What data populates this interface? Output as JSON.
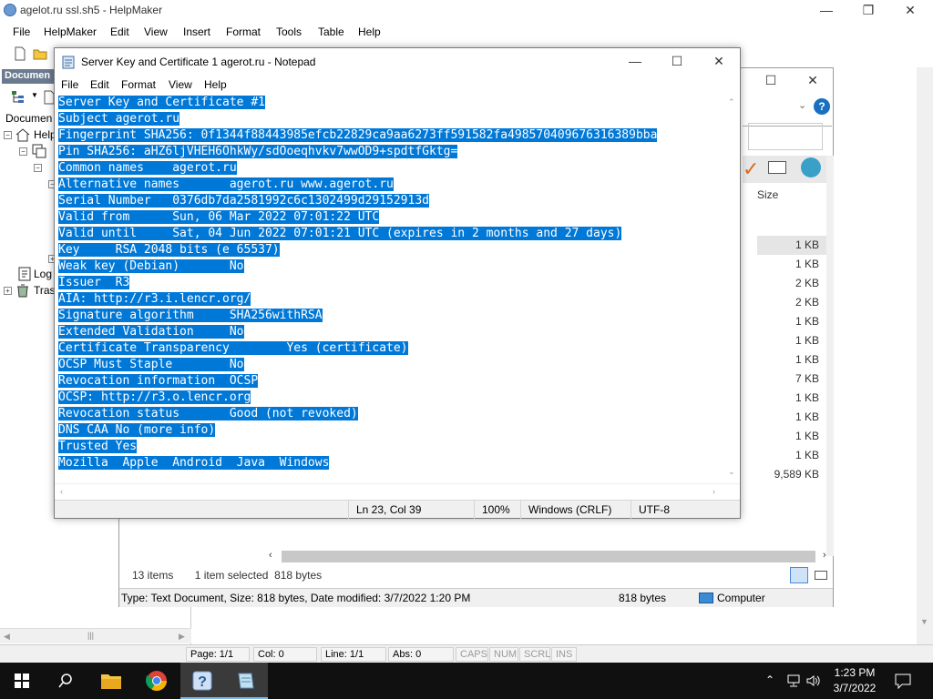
{
  "helpmaker": {
    "title": "agelot.ru ssl.sh5 - HelpMaker",
    "menu": [
      "File",
      "HelpMaker",
      "Edit",
      "View",
      "Insert",
      "Format",
      "Tools",
      "Table",
      "Help"
    ],
    "panel_header": "Documen",
    "panel_label": "Documen",
    "tree": [
      "Help",
      "Log",
      "Tras"
    ],
    "status": {
      "page": "Page: 1/1",
      "col": "Col: 0",
      "line": "Line: 1/1",
      "abs": "Abs: 0",
      "caps": "CAPS",
      "num": "NUM",
      "scrl": "SCRL",
      "ins": "INS"
    }
  },
  "explorer": {
    "column_size": "Size",
    "sizes": [
      "1 KB",
      "1 KB",
      "2 KB",
      "2 KB",
      "1 KB",
      "1 KB",
      "1 KB",
      "7 KB",
      "1 KB",
      "1 KB",
      "1 KB",
      "1 KB",
      "9,589 KB"
    ],
    "selected_index": 0,
    "items_count": "13 items",
    "selection": "1 item selected  818 bytes",
    "status_text": "Type: Text Document, Size: 818 bytes, Date modified: 3/7/2022 1:20 PM",
    "status_size": "818 bytes",
    "status_location": "Computer"
  },
  "notepad": {
    "title": "Server Key and Certificate 1 agerot.ru - Notepad",
    "menu": [
      "File",
      "Edit",
      "Format",
      "View",
      "Help"
    ],
    "lines": [
      "Server Key and Certificate #1",
      "Subject agerot.ru",
      "Fingerprint SHA256: 0f1344f88443985efcb22829ca9aa6273ff591582fa498570409676316389bba",
      "Pin SHA256: aHZ6ljVHEH6OhkWy/sdOoeqhvkv7wwOD9+spdtfGktg=",
      "Common names    agerot.ru",
      "Alternative names       agerot.ru www.agerot.ru",
      "Serial Number   0376db7da2581992c6c1302499d29152913d",
      "Valid from      Sun, 06 Mar 2022 07:01:22 UTC",
      "Valid until     Sat, 04 Jun 2022 07:01:21 UTC (expires in 2 months and 27 days)",
      "Key     RSA 2048 bits (e 65537)",
      "Weak key (Debian)       No",
      "Issuer  R3",
      "AIA: http://r3.i.lencr.org/",
      "Signature algorithm     SHA256withRSA",
      "Extended Validation     No",
      "Certificate Transparency        Yes (certificate)",
      "OCSP Must Staple        No",
      "Revocation information  OCSP",
      "OCSP: http://r3.o.lencr.org",
      "Revocation status       Good (not revoked)",
      "DNS CAA No (more info)",
      "Trusted Yes",
      "Mozilla  Apple  Android  Java  Windows"
    ],
    "status": {
      "position": "Ln 23, Col 39",
      "zoom": "100%",
      "line_ending": "Windows (CRLF)",
      "encoding": "UTF-8"
    }
  },
  "taskbar": {
    "apps": [
      "start-icon",
      "search-icon",
      "file-explorer-icon",
      "chrome-icon",
      "helpmaker-icon",
      "notepad-icon"
    ],
    "time": "1:23 PM",
    "date": "3/7/2022"
  }
}
